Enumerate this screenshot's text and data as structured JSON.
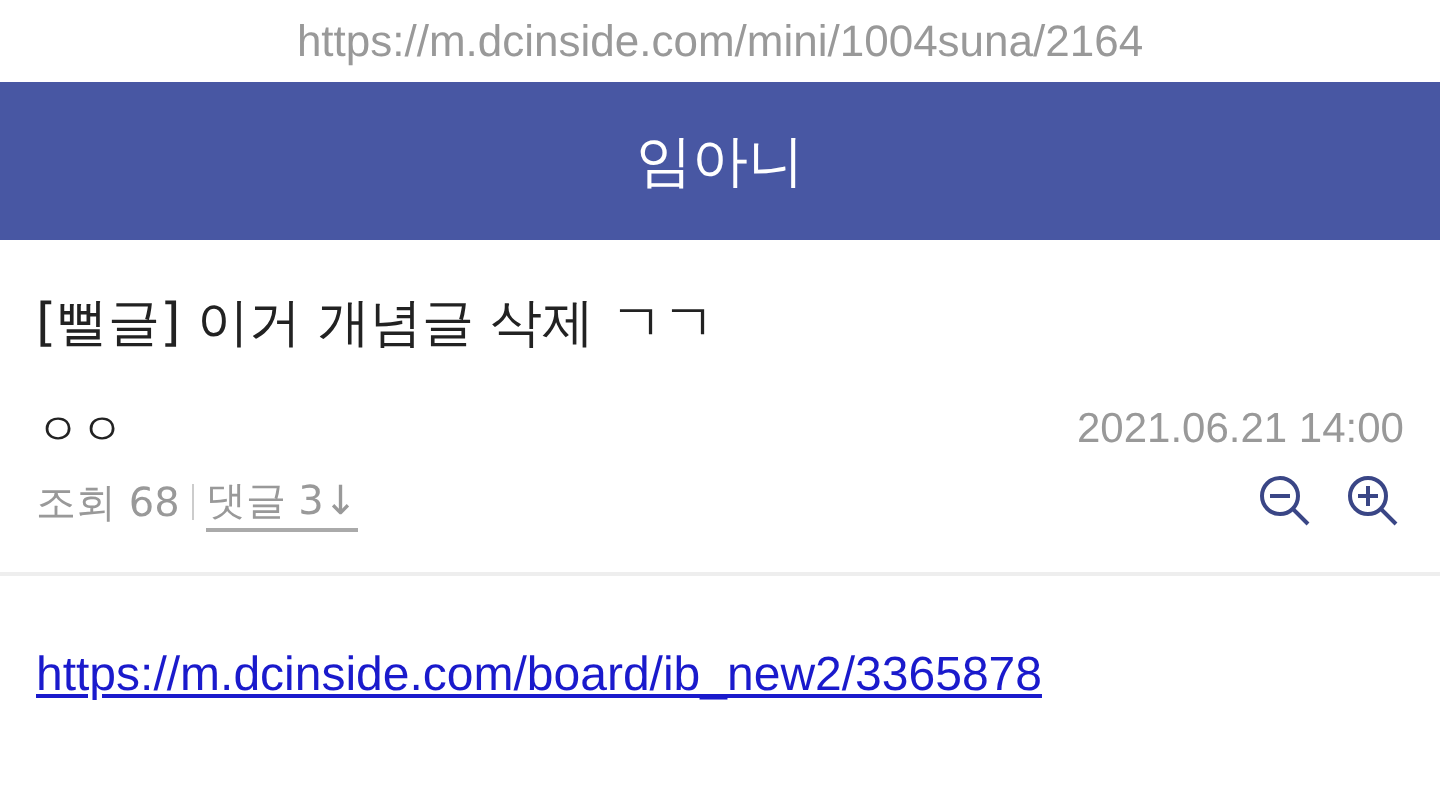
{
  "address_bar": {
    "url": "https://m.dcinside.com/mini/1004suna/2164"
  },
  "header": {
    "title": "임아니"
  },
  "post": {
    "title": "[뻘글] 이거 개념글 삭제 ㄱㄱ",
    "author": "ㅇㅇ",
    "date": "2021.06.21 14:00",
    "views": "조회 68",
    "comments": "댓글 3↓"
  },
  "body": {
    "link": "https://m.dcinside.com/board/ib_new2/3365878"
  }
}
